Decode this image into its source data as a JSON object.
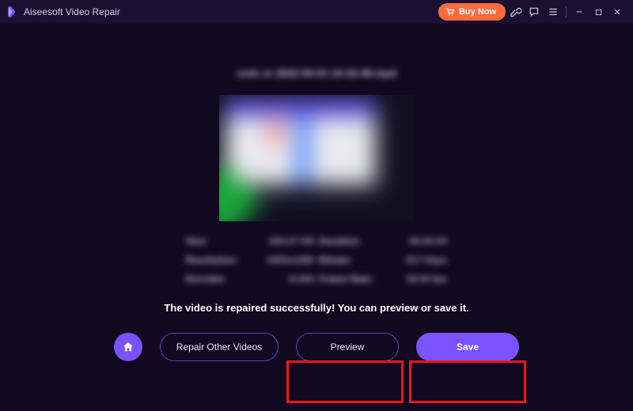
{
  "titlebar": {
    "app_name": "Aiseesoft Video Repair",
    "buy_label": "Buy Now"
  },
  "file": {
    "name": "xxdc xr 2022-04-01 10-33-49.mp4"
  },
  "meta": {
    "size_label": "Size:",
    "size_value": "429.27 KB",
    "duration_label": "Duration:",
    "duration_value": "00:00:04",
    "resolution_label": "Resolution:",
    "resolution_value": "1920x1080",
    "bitrate_label": "Bitrate:",
    "bitrate_value": "817 kbps",
    "encoder_label": "Encoder:",
    "encoder_value": "H.264",
    "framerate_label": "Frame Rate:",
    "framerate_value": "30.00 fps"
  },
  "status": {
    "message": "The video is repaired successfully! You can preview or save it."
  },
  "actions": {
    "repair_other": "Repair Other Videos",
    "preview": "Preview",
    "save": "Save"
  },
  "colors": {
    "accent": "#7a52ff",
    "buy": "#ff6a3d",
    "highlight": "#ff1414",
    "bg": "#100920"
  }
}
